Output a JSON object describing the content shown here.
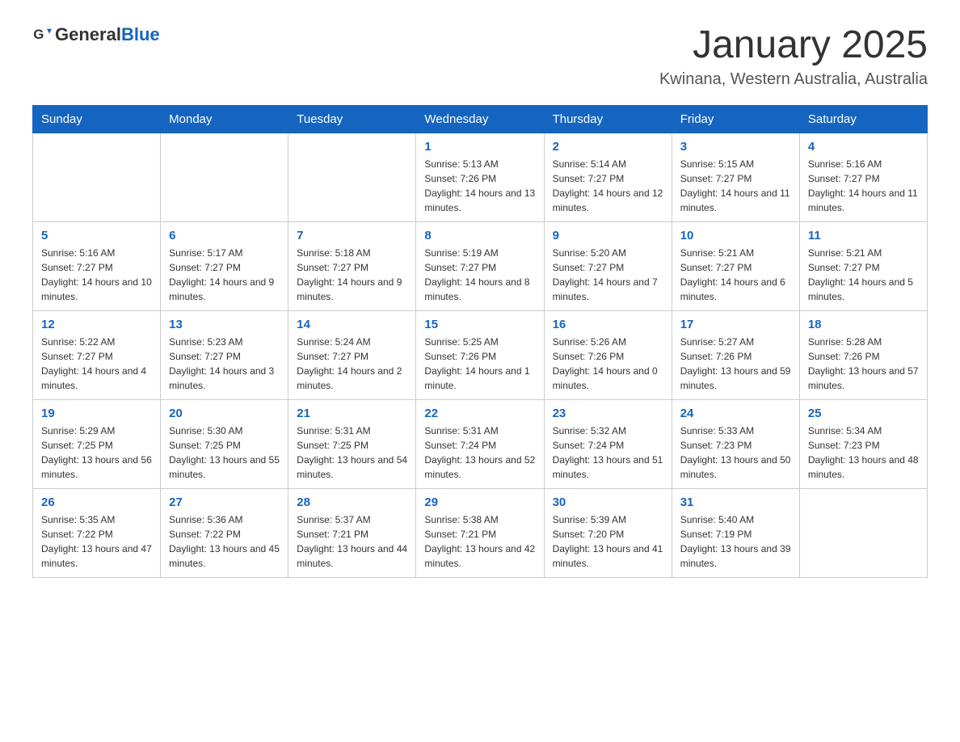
{
  "header": {
    "logo_general": "General",
    "logo_blue": "Blue",
    "title": "January 2025",
    "subtitle": "Kwinana, Western Australia, Australia"
  },
  "days_of_week": [
    "Sunday",
    "Monday",
    "Tuesday",
    "Wednesday",
    "Thursday",
    "Friday",
    "Saturday"
  ],
  "weeks": [
    [
      {
        "day": "",
        "info": ""
      },
      {
        "day": "",
        "info": ""
      },
      {
        "day": "",
        "info": ""
      },
      {
        "day": "1",
        "info": "Sunrise: 5:13 AM\nSunset: 7:26 PM\nDaylight: 14 hours and 13 minutes."
      },
      {
        "day": "2",
        "info": "Sunrise: 5:14 AM\nSunset: 7:27 PM\nDaylight: 14 hours and 12 minutes."
      },
      {
        "day": "3",
        "info": "Sunrise: 5:15 AM\nSunset: 7:27 PM\nDaylight: 14 hours and 11 minutes."
      },
      {
        "day": "4",
        "info": "Sunrise: 5:16 AM\nSunset: 7:27 PM\nDaylight: 14 hours and 11 minutes."
      }
    ],
    [
      {
        "day": "5",
        "info": "Sunrise: 5:16 AM\nSunset: 7:27 PM\nDaylight: 14 hours and 10 minutes."
      },
      {
        "day": "6",
        "info": "Sunrise: 5:17 AM\nSunset: 7:27 PM\nDaylight: 14 hours and 9 minutes."
      },
      {
        "day": "7",
        "info": "Sunrise: 5:18 AM\nSunset: 7:27 PM\nDaylight: 14 hours and 9 minutes."
      },
      {
        "day": "8",
        "info": "Sunrise: 5:19 AM\nSunset: 7:27 PM\nDaylight: 14 hours and 8 minutes."
      },
      {
        "day": "9",
        "info": "Sunrise: 5:20 AM\nSunset: 7:27 PM\nDaylight: 14 hours and 7 minutes."
      },
      {
        "day": "10",
        "info": "Sunrise: 5:21 AM\nSunset: 7:27 PM\nDaylight: 14 hours and 6 minutes."
      },
      {
        "day": "11",
        "info": "Sunrise: 5:21 AM\nSunset: 7:27 PM\nDaylight: 14 hours and 5 minutes."
      }
    ],
    [
      {
        "day": "12",
        "info": "Sunrise: 5:22 AM\nSunset: 7:27 PM\nDaylight: 14 hours and 4 minutes."
      },
      {
        "day": "13",
        "info": "Sunrise: 5:23 AM\nSunset: 7:27 PM\nDaylight: 14 hours and 3 minutes."
      },
      {
        "day": "14",
        "info": "Sunrise: 5:24 AM\nSunset: 7:27 PM\nDaylight: 14 hours and 2 minutes."
      },
      {
        "day": "15",
        "info": "Sunrise: 5:25 AM\nSunset: 7:26 PM\nDaylight: 14 hours and 1 minute."
      },
      {
        "day": "16",
        "info": "Sunrise: 5:26 AM\nSunset: 7:26 PM\nDaylight: 14 hours and 0 minutes."
      },
      {
        "day": "17",
        "info": "Sunrise: 5:27 AM\nSunset: 7:26 PM\nDaylight: 13 hours and 59 minutes."
      },
      {
        "day": "18",
        "info": "Sunrise: 5:28 AM\nSunset: 7:26 PM\nDaylight: 13 hours and 57 minutes."
      }
    ],
    [
      {
        "day": "19",
        "info": "Sunrise: 5:29 AM\nSunset: 7:25 PM\nDaylight: 13 hours and 56 minutes."
      },
      {
        "day": "20",
        "info": "Sunrise: 5:30 AM\nSunset: 7:25 PM\nDaylight: 13 hours and 55 minutes."
      },
      {
        "day": "21",
        "info": "Sunrise: 5:31 AM\nSunset: 7:25 PM\nDaylight: 13 hours and 54 minutes."
      },
      {
        "day": "22",
        "info": "Sunrise: 5:31 AM\nSunset: 7:24 PM\nDaylight: 13 hours and 52 minutes."
      },
      {
        "day": "23",
        "info": "Sunrise: 5:32 AM\nSunset: 7:24 PM\nDaylight: 13 hours and 51 minutes."
      },
      {
        "day": "24",
        "info": "Sunrise: 5:33 AM\nSunset: 7:23 PM\nDaylight: 13 hours and 50 minutes."
      },
      {
        "day": "25",
        "info": "Sunrise: 5:34 AM\nSunset: 7:23 PM\nDaylight: 13 hours and 48 minutes."
      }
    ],
    [
      {
        "day": "26",
        "info": "Sunrise: 5:35 AM\nSunset: 7:22 PM\nDaylight: 13 hours and 47 minutes."
      },
      {
        "day": "27",
        "info": "Sunrise: 5:36 AM\nSunset: 7:22 PM\nDaylight: 13 hours and 45 minutes."
      },
      {
        "day": "28",
        "info": "Sunrise: 5:37 AM\nSunset: 7:21 PM\nDaylight: 13 hours and 44 minutes."
      },
      {
        "day": "29",
        "info": "Sunrise: 5:38 AM\nSunset: 7:21 PM\nDaylight: 13 hours and 42 minutes."
      },
      {
        "day": "30",
        "info": "Sunrise: 5:39 AM\nSunset: 7:20 PM\nDaylight: 13 hours and 41 minutes."
      },
      {
        "day": "31",
        "info": "Sunrise: 5:40 AM\nSunset: 7:19 PM\nDaylight: 13 hours and 39 minutes."
      },
      {
        "day": "",
        "info": ""
      }
    ]
  ]
}
